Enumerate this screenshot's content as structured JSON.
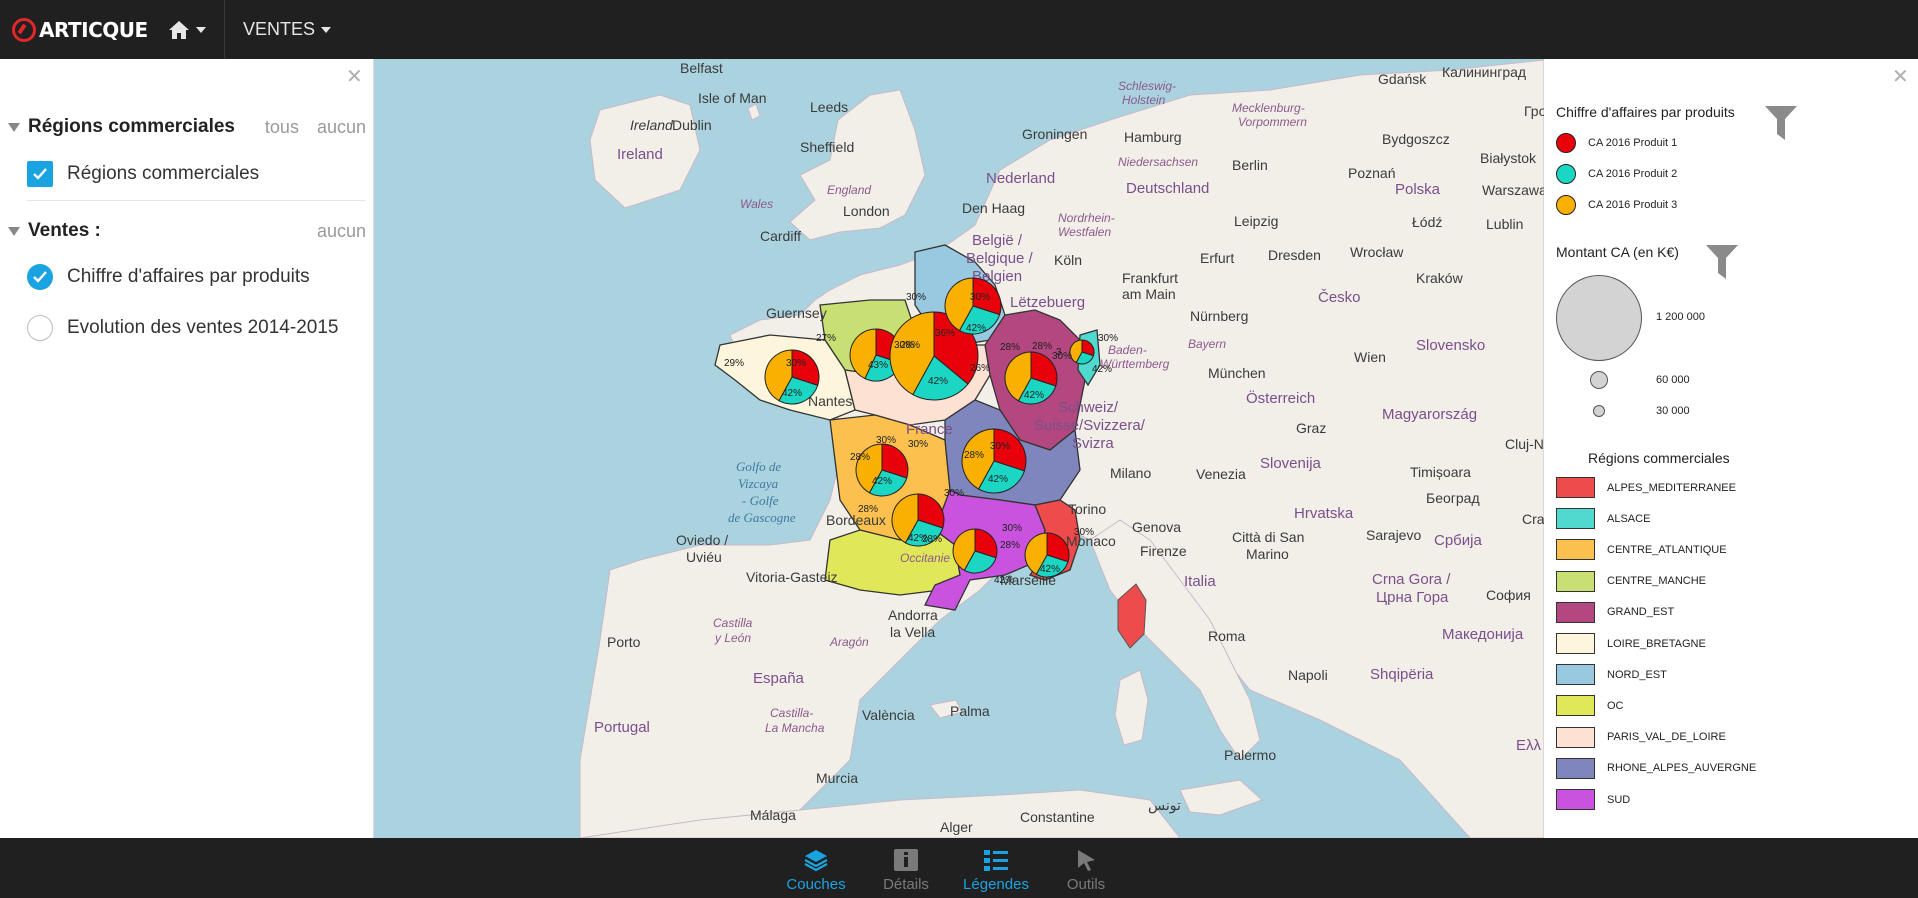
{
  "app": {
    "logo_text": "ARTICQUE",
    "menu_label": "VENTES"
  },
  "left_panel": {
    "groups": [
      {
        "title": "Régions commerciales",
        "link_all": "tous",
        "link_none": "aucun",
        "layers": [
          {
            "label": "Régions commerciales",
            "checked": true,
            "control": "checkbox"
          }
        ]
      },
      {
        "title": "Ventes :",
        "link_none": "aucun",
        "layers": [
          {
            "label": "Chiffre d'affaires par produits",
            "checked": true,
            "control": "radio"
          },
          {
            "label": "Evolution des ventes 2014-2015",
            "checked": false,
            "control": "radio"
          }
        ]
      }
    ]
  },
  "map": {
    "place_labels": {
      "belfast": "Belfast",
      "isle_of_man": "Isle of Man",
      "leeds": "Leeds",
      "ireland_dublin_a": "Ireland",
      "ireland_dublin_b": "Dublin",
      "ireland": "Ireland",
      "sheffield": "Sheffield",
      "england": "England",
      "wales": "Wales",
      "london": "London",
      "cardiff": "Cardiff",
      "guernsey": "Guernsey",
      "nantes": "Nantes",
      "france": "France",
      "bordeaux": "Bordeaux",
      "golfo_1": "Golfo de",
      "golfo_2": "Vizcaya",
      "golfo_3": "- Golfe",
      "golfo_4": "de Gascogne",
      "oviedo_1": "Oviedo /",
      "oviedo_2": "Uviéu",
      "vitoria": "Vitoria-Gasteiz",
      "andorra_1": "Andorra",
      "andorra_2": "la Vella",
      "occitanie": "Occitanie",
      "marseille": "Marseille",
      "castilla_1": "Castilla",
      "castilla_2": "y León",
      "aragon": "Aragón",
      "porto": "Porto",
      "espana": "España",
      "castilla_lm_1": "Castilla-",
      "castilla_lm_2": "La Mancha",
      "valencia": "València",
      "palma": "Palma",
      "portugal": "Portugal",
      "murcia": "Murcia",
      "malaga": "Málaga",
      "constantine": "Constantine",
      "tunis": "تونس",
      "alger": "Alger",
      "schleswig_1": "Schleswig-",
      "schleswig_2": "Holstein",
      "gdansk": "Gdańsk",
      "kaliningrad": "Калининград",
      "mecklenburg_1": "Mecklenburg-",
      "mecklenburg_2": "Vorpommern",
      "groningen": "Groningen",
      "hamburg": "Hamburg",
      "bydgoszcz": "Bydgoszcz",
      "bialystok": "Białystok",
      "niedersachsen": "Niedersachsen",
      "berlin": "Berlin",
      "poznan": "Poznań",
      "nederland": "Nederland",
      "deutschland": "Deutschland",
      "polska": "Polska",
      "warszawa": "Warszawa",
      "den_haag": "Den Haag",
      "leipzig": "Leipzig",
      "lodz": "Łódź",
      "lublin": "Lublin",
      "nordrhein_1": "Nordrhein-",
      "nordrhein_2": "Westfalen",
      "dresden": "Dresden",
      "wroclaw": "Wrocław",
      "belgique_1": "België /",
      "belgique_2": "Belgique /",
      "belgique_3": "Belgien",
      "koln": "Köln",
      "frankfurt_1": "Frankfurt",
      "frankfurt_2": "am Main",
      "erfurt": "Erfurt",
      "krakow": "Kraków",
      "cesko": "Česko",
      "luxembourg": "Lëtzebuerg",
      "nurnberg": "Nürnberg",
      "baden_1": "Baden-",
      "baden_2": "Württemberg",
      "bayern": "Bayern",
      "wien": "Wien",
      "slovensko": "Slovensko",
      "munchen": "München",
      "osterreich": "Österreich",
      "schweiz_1": "Schweiz/",
      "schweiz_2": "Suisse/Svizzera/",
      "schweiz_3": "Svizra",
      "graz": "Graz",
      "magyarorszag": "Magyarország",
      "cluj": "Cluj-Na",
      "milano": "Milano",
      "venezia": "Venezia",
      "slovenija": "Slovenija",
      "timisoara": "Timișoara",
      "torino": "Torino",
      "hrvatska": "Hrvatska",
      "beograd": "Београд",
      "genova": "Genova",
      "monaco": "Monaco",
      "citta_1": "Città di San",
      "citta_2": "Marino",
      "sarajevo": "Sarajevo",
      "srbija": "Србија",
      "firenze": "Firenze",
      "italia": "Italia",
      "crna_1": "Crna Gora /",
      "crna_2": "Црна Гора",
      "sofia": "София",
      "roma": "Roma",
      "makedonija": "Македонија",
      "napoli": "Napoli",
      "shqiperia": "Shqipëria",
      "palermo": "Palermo",
      "ellada": "Ελλ",
      "gro": "Гро",
      "cra": "Cra"
    },
    "pie_labels": {
      "p30": "30%",
      "p28": "28%",
      "p42": "42%",
      "p43": "43%",
      "p27": "27%",
      "p29": "29%",
      "p36": "36%",
      "p26": "26%",
      "p3": "3"
    },
    "pies": [
      {
        "region": "LOIRE_BRETAGNE",
        "p1": 30,
        "p2": 28,
        "p3": 42
      },
      {
        "region": "CENTRE_MANCHE",
        "p1": 30,
        "p2": 27,
        "p3": 43
      },
      {
        "region": "PARIS_VAL_DE_LOIRE",
        "p1": 36,
        "p2": 22,
        "p3": 42
      },
      {
        "region": "NORD_EST",
        "p1": 30,
        "p2": 28,
        "p3": 42
      },
      {
        "region": "GRAND_EST",
        "p1": 30,
        "p2": 28,
        "p3": 42
      },
      {
        "region": "ALSACE",
        "p1": 30,
        "p2": 28,
        "p3": 42
      },
      {
        "region": "CENTRE_ATLANTIQUE",
        "p1": 30,
        "p2": 28,
        "p3": 42
      },
      {
        "region": "RHONE_ALPES_AUVERGNE",
        "p1": 30,
        "p2": 28,
        "p3": 42
      },
      {
        "region": "OC",
        "p1": 30,
        "p2": 28,
        "p3": 42
      },
      {
        "region": "SUD",
        "p1": 30,
        "p2": 28,
        "p3": 42
      },
      {
        "region": "ALPES_MEDITERRANEE",
        "p1": 30,
        "p2": 28,
        "p3": 42
      }
    ]
  },
  "legend": {
    "products_title": "Chiffre d'affaires par produits",
    "products": [
      {
        "label": "CA 2016 Produit 1",
        "color": "#e8000b"
      },
      {
        "label": "CA 2016 Produit 2",
        "color": "#1cd6c4"
      },
      {
        "label": "CA 2016 Produit 3",
        "color": "#f9b000"
      }
    ],
    "amount_title": "Montant CA (en K€)",
    "amounts": [
      {
        "label": "1 200 000"
      },
      {
        "label": "60 000"
      },
      {
        "label": "30 000"
      }
    ],
    "regions_title": "Régions commerciales",
    "regions": [
      {
        "label": "ALPES_MEDITERRANEE",
        "color": "#ee4c4c"
      },
      {
        "label": "ALSACE",
        "color": "#4fd9cf"
      },
      {
        "label": "CENTRE_ATLANTIQUE",
        "color": "#fbc04d"
      },
      {
        "label": "CENTRE_MANCHE",
        "color": "#c7df73"
      },
      {
        "label": "GRAND_EST",
        "color": "#b3477f"
      },
      {
        "label": "LOIRE_BRETAGNE",
        "color": "#fdf5dc"
      },
      {
        "label": "NORD_EST",
        "color": "#98c9e0"
      },
      {
        "label": "OC",
        "color": "#e0e85a"
      },
      {
        "label": "PARIS_VAL_DE_LOIRE",
        "color": "#fde1d2"
      },
      {
        "label": "RHONE_ALPES_AUVERGNE",
        "color": "#7f86bd"
      },
      {
        "label": "SUD",
        "color": "#c953de"
      }
    ]
  },
  "bottom_nav": [
    {
      "label": "Couches",
      "icon": "layers-icon",
      "active": true
    },
    {
      "label": "Détails",
      "icon": "info-icon",
      "active": false
    },
    {
      "label": "Légendes",
      "icon": "legend-icon",
      "active": true
    },
    {
      "label": "Outils",
      "icon": "cursor-icon",
      "active": false
    }
  ],
  "colors": {
    "accent": "#1aa3e1",
    "bar_bg": "#202020",
    "map_water": "#aad3df",
    "map_land": "#f2efe9"
  }
}
